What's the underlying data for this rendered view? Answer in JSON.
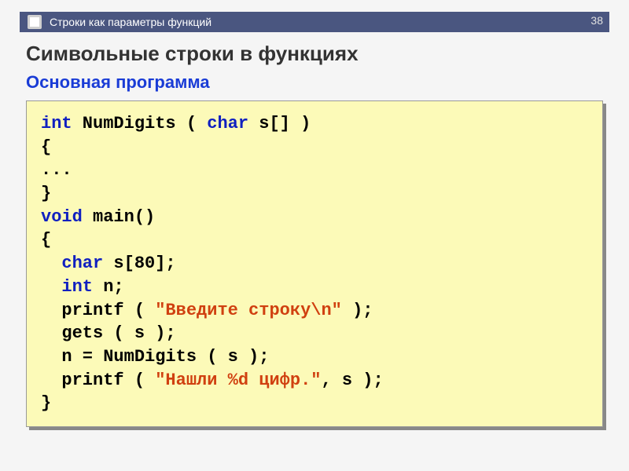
{
  "header": {
    "text": "Строки как параметры функций",
    "page_number": "38"
  },
  "title": "Символьные строки в функциях",
  "subtitle": "Основная программа",
  "code": {
    "l1_kw1": "int",
    "l1_mid": " NumDigits ( ",
    "l1_kw2": "char",
    "l1_end": " s[] )",
    "l2": "{",
    "l3": "...",
    "l4": "}",
    "l5_kw": "void",
    "l5_end": " main()",
    "l6": "{",
    "l7_pad": "  ",
    "l7_kw": "char",
    "l7_end": " s[80];",
    "l8_pad": "  ",
    "l8_kw": "int",
    "l8_end": " n;",
    "l9_pad": "  ",
    "l9_fn": "printf",
    "l9_mid": " ( ",
    "l9_str": "\"Введите строку\\n\"",
    "l9_end": " );",
    "l10_pad": "  ",
    "l10_txt": "gets ( s );",
    "l11_pad": "  ",
    "l11_txt": "n = NumDigits ( s );",
    "l12_pad": "  ",
    "l12_fn": "printf",
    "l12_mid": " ( ",
    "l12_str": "\"Нашли %d цифр.\"",
    "l12_end": ", s );",
    "l13": "}"
  }
}
